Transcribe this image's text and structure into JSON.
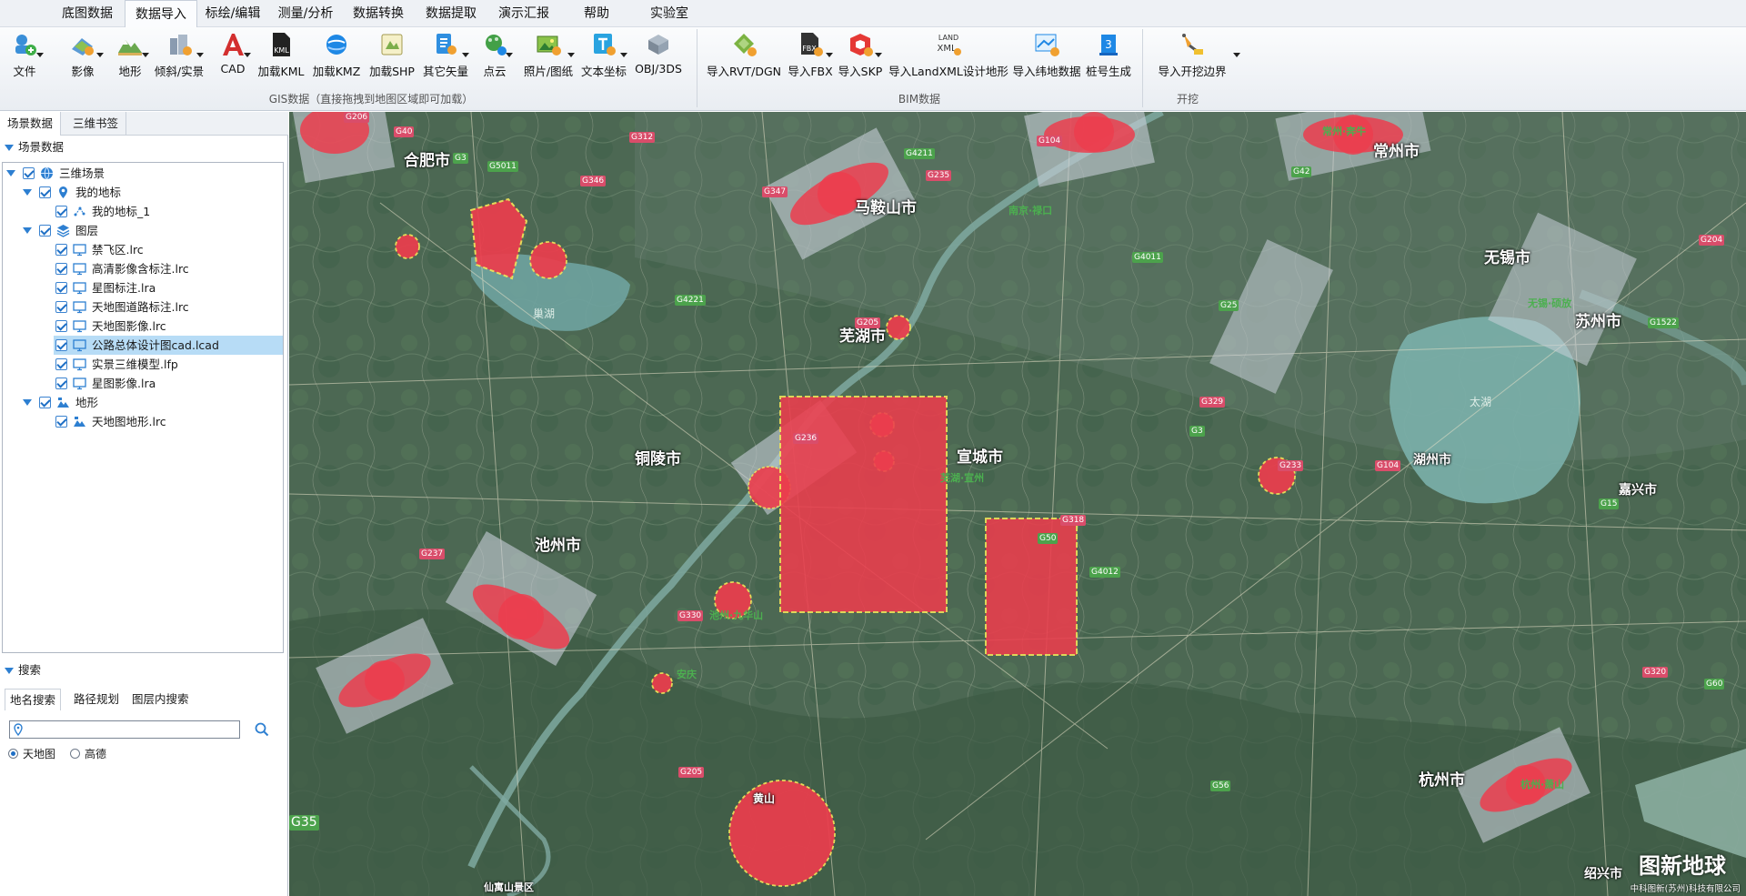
{
  "menu": {
    "tabs": [
      "底图数据",
      "数据导入",
      "标绘/编辑",
      "测量/分析",
      "数据转换",
      "数据提取",
      "演示汇报",
      "帮助",
      "实验室"
    ],
    "active_index": 1
  },
  "ribbon": {
    "file": "文件",
    "gis": [
      "影像",
      "地形",
      "倾斜/实景",
      "CAD",
      "加载KML",
      "加载KMZ",
      "加载SHP",
      "其它矢量",
      "点云",
      "照片/图纸",
      "文本坐标",
      "OBJ/3DS"
    ],
    "gis_group": "GIS数据（直接拖拽到地图区域即可加载）",
    "bim": [
      "导入RVT/DGN",
      "导入FBX",
      "导入SKP",
      "导入LandXML设计地形",
      "导入纬地数据",
      "桩号生成"
    ],
    "bim_group": "BIM数据",
    "excavation": [
      "导入开挖边界"
    ],
    "excavation_group": "开挖",
    "icon_badges": {
      "kml": "KML",
      "fbx": "FBX",
      "landxml_top": "LAND",
      "landxml_bottom": "XML",
      "stake": "3"
    }
  },
  "left_panel": {
    "tabs": [
      "场景数据",
      "三维书签"
    ],
    "scene_header": "场景数据",
    "tree": {
      "root": "三维场景",
      "my_places": "我的地标",
      "place_1": "我的地标_1",
      "layers": "图层",
      "layer_items": [
        "禁飞区.lrc",
        "高清影像含标注.lrc",
        "星图标注.lra",
        "天地图道路标注.lrc",
        "天地图影像.lrc",
        "公路总体设计图cad.lcad",
        "实景三维模型.lfp",
        "星图影像.lra"
      ],
      "selected_layer_index": 5,
      "terrain": "地形",
      "terrain_items": [
        "天地图地形.lrc"
      ]
    },
    "search": {
      "header": "搜索",
      "tabs": [
        "地名搜索",
        "路径规划",
        "图层内搜索"
      ],
      "value": "",
      "radios": [
        "天地图",
        "高德"
      ],
      "radio_selected": 0
    }
  },
  "map": {
    "cities": [
      "合肥市",
      "马鞍山市",
      "芜湖市",
      "铜陵市",
      "宣城市",
      "池州市",
      "常州市",
      "无锡市",
      "苏州市",
      "湖州市",
      "杭州市",
      "嘉兴市",
      "绍兴市",
      "黄山",
      "巢湖",
      "太湖",
      "仙寓山景区",
      "南京·禄口",
      "常州·奔牛",
      "无锡·硕放",
      "芜湖·宣州",
      "池州·九华山",
      "安庆",
      "杭州·萧山"
    ],
    "roads": [
      "G40",
      "G3",
      "G312",
      "G206",
      "G5011",
      "G346",
      "G347",
      "G235",
      "G4211",
      "G104",
      "G4221",
      "G42",
      "G25",
      "G205",
      "G4011",
      "G236",
      "G330",
      "G318",
      "G237",
      "G50",
      "G4012",
      "G3",
      "G35",
      "G56",
      "G60",
      "G104",
      "G329",
      "G205",
      "G233",
      "G1522",
      "G204",
      "G320",
      "G15"
    ],
    "watermark": "图新地球",
    "copyright": "中科图新(苏州)科技有限公司"
  }
}
